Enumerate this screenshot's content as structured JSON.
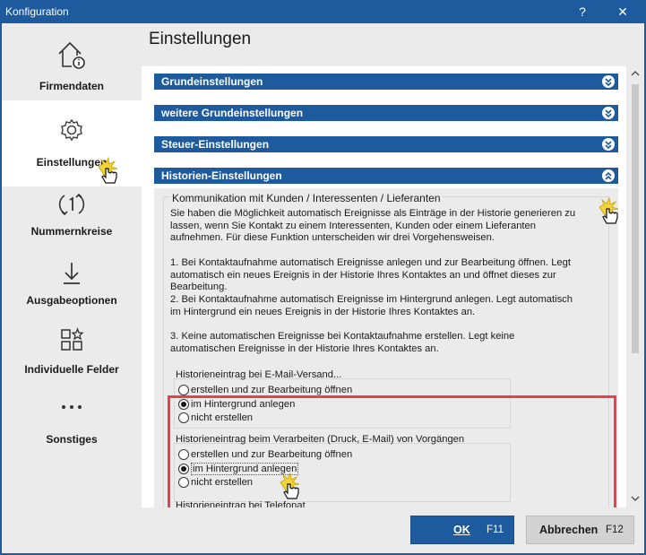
{
  "window": {
    "title": "Konfiguration",
    "help_glyph": "?",
    "close_glyph": "✕"
  },
  "sidebar": {
    "items": [
      {
        "label": "Firmendaten",
        "icon": "home-info-icon"
      },
      {
        "label": "Einstellungen",
        "icon": "gear-icon",
        "selected": true
      },
      {
        "label": "Nummernkreise",
        "icon": "refresh-number-icon"
      },
      {
        "label": "Ausgabeoptionen",
        "icon": "download-icon"
      },
      {
        "label": "Individuelle Felder",
        "icon": "custom-fields-icon"
      },
      {
        "label": "Sonstiges",
        "icon": "more-icon"
      }
    ]
  },
  "content": {
    "page_title": "Einstellungen",
    "sections": [
      {
        "label": "Grundeinstellungen",
        "state": "collapsed"
      },
      {
        "label": "weitere Grundeinstellungen",
        "state": "collapsed"
      },
      {
        "label": "Steuer-Einstellungen",
        "state": "collapsed"
      },
      {
        "label": "Historien-Einstellungen",
        "state": "expanded"
      }
    ],
    "historien": {
      "group_title": "Kommunikation mit Kunden / Interessenten / Lieferanten",
      "intro": "Sie haben die Möglichkeit automatisch Ereignisse als Einträge in der Historie generieren zu lassen, wenn Sie Kontakt zu einem Interessenten, Kunden oder einem Lieferanten aufnehmen. Für diese Funktion unterscheiden wir drei Vorgehensweisen.",
      "option1": "1. Bei Kontaktaufnahme automatisch Ereignisse anlegen und zur Bearbeitung öffnen. Legt automatisch ein neues Ereignis in der Historie Ihres Kontaktes an und öffnet dieses zur Bearbeitung.",
      "option2": "2. Bei Kontaktaufnahme automatisch Ereignisse im Hintergrund anlegen. Legt automatisch im Hintergrund ein neues Ereignis in der Historie Ihres Kontaktes an.",
      "option3": "3. Keine automatischen Ereignisse bei Kontaktaufnahme erstellen. Legt keine automatischen Ereignisse in der Historie Ihres Kontaktes an.",
      "email_group": {
        "title": "Historieneintrag bei E-Mail-Versand...",
        "options": [
          "erstellen und zur Bearbeitung öffnen",
          "im Hintergrund anlegen",
          "nicht erstellen"
        ],
        "selected_index": 1
      },
      "process_group": {
        "title": "Historieneintrag beim Verarbeiten (Druck, E-Mail) von Vorgängen",
        "options": [
          "erstellen und zur Bearbeitung öffnen",
          "im Hintergrund anlegen",
          "nicht erstellen"
        ],
        "selected_index": 1
      },
      "next_group_title_partial": "Historieneintrag bei Telefonat"
    }
  },
  "footer": {
    "ok_label": "OK",
    "ok_key": "F11",
    "cancel_label": "Abbrechen",
    "cancel_key": "F12"
  },
  "colors": {
    "accent": "#1e5a9e",
    "highlight": "#e8414d",
    "background": "#ebebeb"
  }
}
